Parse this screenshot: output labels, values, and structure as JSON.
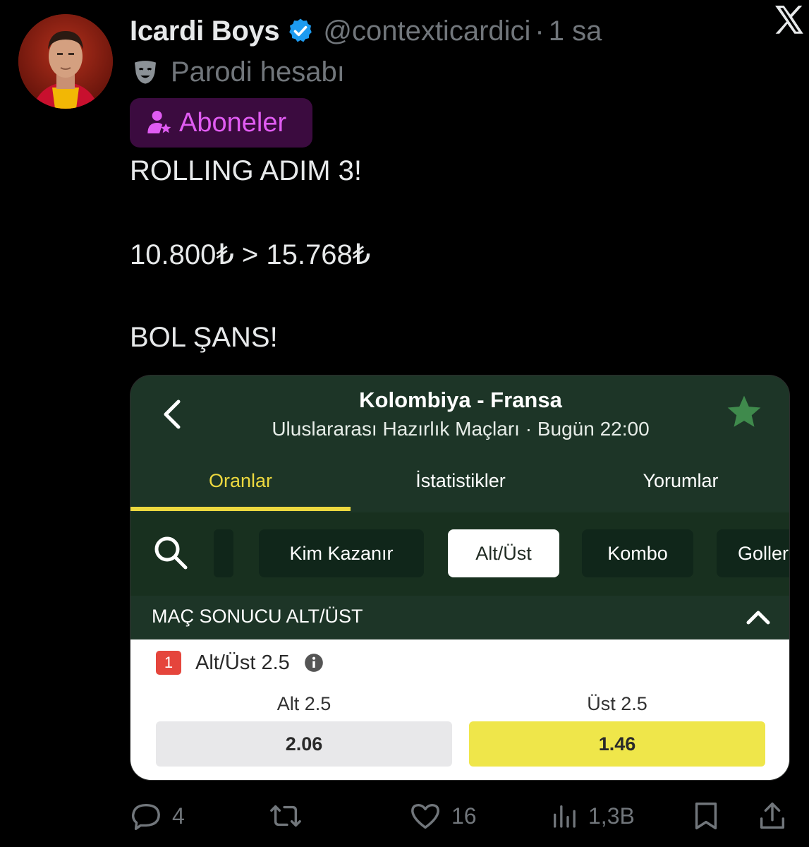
{
  "tweet": {
    "display_name": "Icardi Boys",
    "handle": "@contexticardici",
    "separator": "·",
    "time": "1 sa",
    "parody_label": "Parodi hesabı",
    "subscribers_badge": "Aboneler",
    "lines": [
      "ROLLING ADIM 3!",
      "10.800₺ > 15.768₺",
      "BOL ŞANS!"
    ],
    "verified_color": "#1d9bf0",
    "badge_accent": "#e05cf2"
  },
  "card": {
    "match_title": "Kolombiya - Fransa",
    "match_subtitle": "Uluslararası Hazırlık Maçları · Bugün 22:00",
    "tabs": [
      "Oranlar",
      "İstatistikler",
      "Yorumlar"
    ],
    "active_tab": "Oranlar",
    "chips": [
      "Kim Kazanır",
      "Alt/Üst",
      "Kombo",
      "Goller"
    ],
    "selected_chip": "Alt/Üst",
    "section_title": "MAÇ SONUCU ALT/ÜST",
    "market": {
      "number": "1",
      "name": "Alt/Üst 2.5",
      "options": [
        {
          "label": "Alt 2.5",
          "odd": "2.06"
        },
        {
          "label": "Üst 2.5",
          "odd": "1.46"
        }
      ]
    },
    "colors": {
      "bg": "#1d3527",
      "accent": "#ecd83f",
      "highlight_odd": "#efe64a"
    }
  },
  "actions": {
    "replies": "4",
    "likes": "16",
    "views": "1,3B"
  },
  "icons": [
    "x-logo-icon",
    "verified-icon",
    "theater-mask-icon",
    "subscriber-star-icon",
    "chevron-left-icon",
    "star-icon",
    "search-icon",
    "chevron-up-icon",
    "info-icon",
    "reply-icon",
    "retweet-icon",
    "heart-icon",
    "views-icon",
    "bookmark-icon",
    "share-icon"
  ]
}
